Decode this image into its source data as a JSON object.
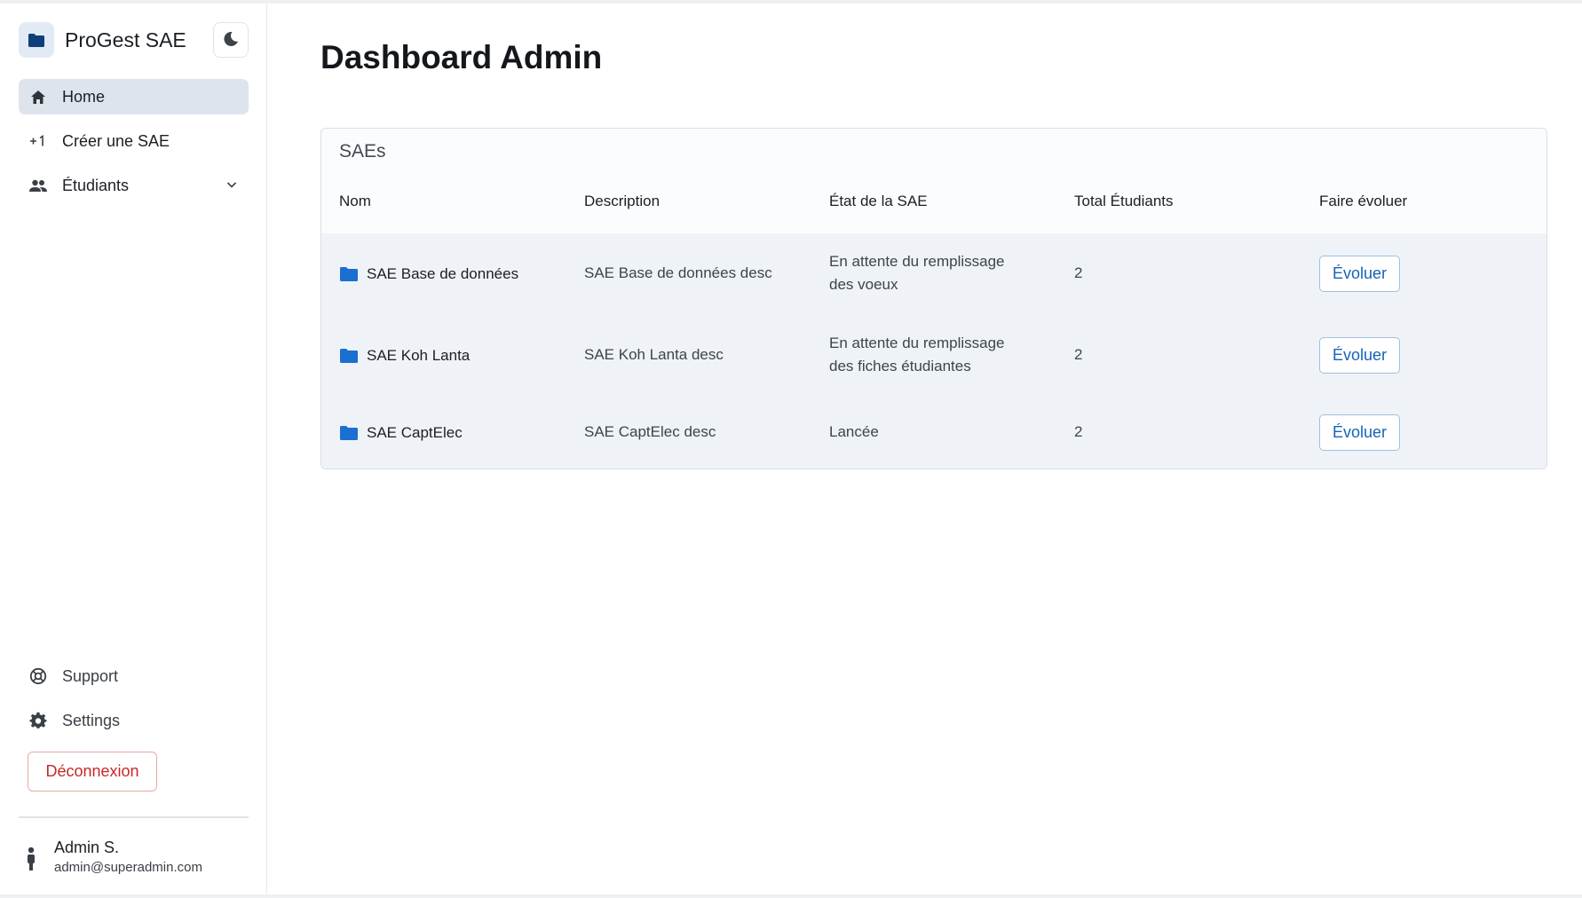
{
  "app": {
    "name": "ProGest SAE"
  },
  "nav": {
    "items": [
      {
        "label": "Home",
        "icon": "home-icon",
        "active": true
      },
      {
        "label": "Créer une SAE",
        "icon": "plus-one-icon",
        "active": false
      },
      {
        "label": "Étudiants",
        "icon": "people-icon",
        "active": false,
        "expandable": true
      }
    ],
    "bottom": [
      {
        "label": "Support",
        "icon": "support-icon"
      },
      {
        "label": "Settings",
        "icon": "gear-icon"
      }
    ],
    "logout_label": "Déconnexion"
  },
  "user": {
    "name": "Admin S.",
    "email": "admin@superadmin.com"
  },
  "page": {
    "title": "Dashboard Admin"
  },
  "table": {
    "caption": "SAEs",
    "columns": [
      "Nom",
      "Description",
      "État de la SAE",
      "Total Étudiants",
      "Faire évoluer"
    ],
    "rows": [
      {
        "name": "SAE Base de données",
        "description": "SAE Base de données desc",
        "state_line1": "En attente du remplissage",
        "state_line2": "des voeux",
        "total": "2",
        "action": "Évoluer"
      },
      {
        "name": "SAE Koh Lanta",
        "description": "SAE Koh Lanta desc",
        "state_line1": "En attente du remplissage",
        "state_line2": "des fiches étudiantes",
        "total": "2",
        "action": "Évoluer"
      },
      {
        "name": "SAE CaptElec",
        "description": "SAE CaptElec desc",
        "state_line1": "Lancée",
        "state_line2": "",
        "total": "2",
        "action": "Évoluer"
      }
    ]
  },
  "colors": {
    "accent": "#1763b8",
    "folder": "#1a6fd1",
    "danger": "#c62828",
    "active_nav_bg": "#dde4ec",
    "table_body_bg": "#eff3f7"
  }
}
